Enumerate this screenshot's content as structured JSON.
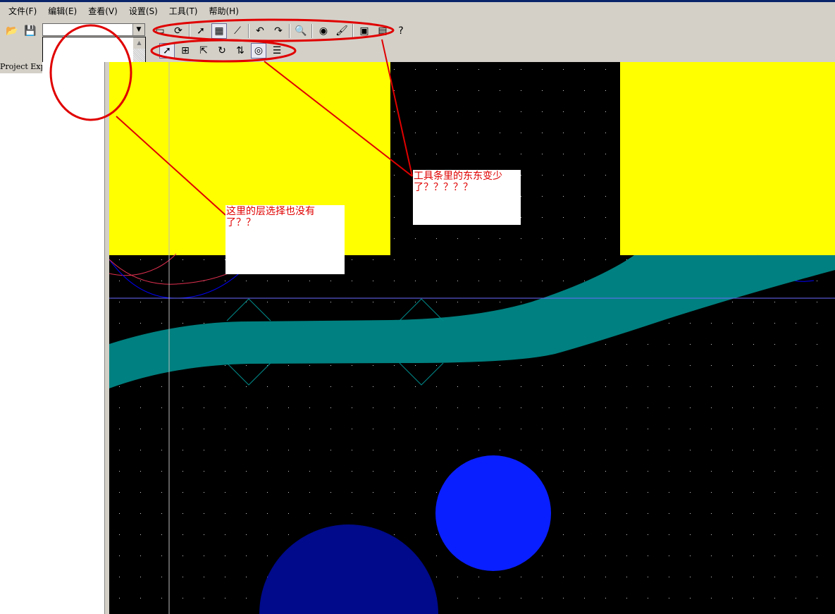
{
  "menu": [
    "文件(F)",
    "编辑(E)",
    "查看(V)",
    "设置(S)",
    "工具(T)",
    "帮助(H)"
  ],
  "toolbar1": [
    {
      "icon": "open-icon",
      "g": "📂"
    },
    {
      "icon": "save-icon",
      "g": "💾"
    }
  ],
  "toolbar2": [
    {
      "icon": "disabled-icon",
      "g": "▭"
    },
    {
      "icon": "refresh-icon",
      "g": "⟳"
    },
    {
      "icon": "select-arrow-icon",
      "g": "➚"
    },
    {
      "icon": "grid-icon",
      "g": "▦"
    },
    {
      "icon": "route-icon",
      "g": "⟋"
    },
    {
      "icon": "undo-icon",
      "g": "↶"
    },
    {
      "icon": "redo-icon",
      "g": "↷"
    },
    {
      "icon": "zoom-icon",
      "g": "🔍"
    },
    {
      "icon": "view-icon",
      "g": "◉"
    },
    {
      "icon": "brush-icon",
      "g": "🖌"
    },
    {
      "icon": "image-icon",
      "g": "▣"
    },
    {
      "icon": "window-icon",
      "g": "▤"
    },
    {
      "icon": "help-icon",
      "g": "?"
    }
  ],
  "toolbar3": [
    {
      "icon": "pointer-icon",
      "g": "➚"
    },
    {
      "icon": "select-box-icon",
      "g": "⊞"
    },
    {
      "icon": "move-icon",
      "g": "⇱"
    },
    {
      "icon": "rotate-icon",
      "g": "↻"
    },
    {
      "icon": "flip-icon",
      "g": "⇅"
    },
    {
      "icon": "component-icon",
      "g": "◎"
    },
    {
      "icon": "list-icon",
      "g": "☰"
    }
  ],
  "panel": {
    "project_explorer": "Project Explorer"
  },
  "annotations": {
    "layer": "这里的层选择也没有了？？",
    "toolbar": "工具条里的东东变少了？？？？？"
  },
  "colors": {
    "copper": "#ffff00",
    "trace": "#008080",
    "pad": "#0a1fff",
    "pad2": "#000a8a",
    "mark": "#e00000"
  }
}
